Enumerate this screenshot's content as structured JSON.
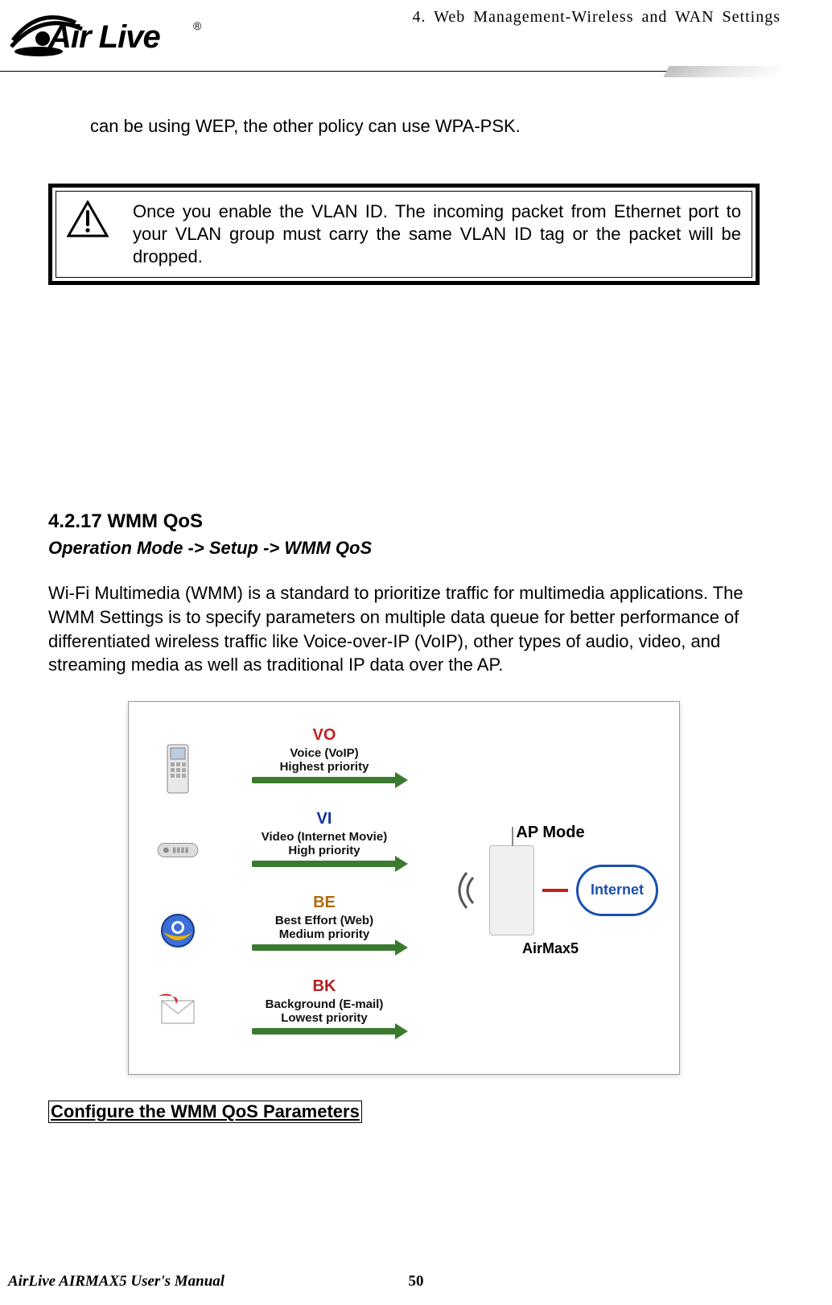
{
  "header": {
    "logo_name": "Air Live",
    "chapter_title": "4. Web Management-Wireless and WAN Settings"
  },
  "intro_line": "can be using WEP, the other policy can use WPA-PSK.",
  "warning_text": "Once you enable the VLAN ID.  The incoming packet from Ethernet port to your VLAN group must carry the same VLAN ID tag or the packet will be dropped.",
  "section": {
    "number": "4.2.17",
    "title": "WMM QoS",
    "breadcrumb": "Operation Mode -> Setup -> WMM QoS",
    "paragraph": "Wi-Fi Multimedia (WMM) is a standard to prioritize traffic for multimedia applications.   The WMM Settings is to specify parameters on multiple data queue for better performance of differentiated wireless traffic like Voice-over-IP (VoIP), other types of audio, video, and streaming media as well as traditional IP data over the AP.",
    "sub_heading": "Configure the WMM QoS Parameters"
  },
  "diagram": {
    "ap_mode_label": "AP Mode",
    "device_label": "AirMax5",
    "internet_label": "Internet",
    "rows": [
      {
        "code": "VO",
        "desc1": "Voice (VoIP)",
        "desc2": "Highest priority"
      },
      {
        "code": "VI",
        "desc1": "Video (Internet Movie)",
        "desc2": "High priority"
      },
      {
        "code": "BE",
        "desc1": "Best Effort (Web)",
        "desc2": "Medium priority"
      },
      {
        "code": "BK",
        "desc1": "Background (E-mail)",
        "desc2": "Lowest priority"
      }
    ]
  },
  "footer": {
    "manual_name": "AirLive AIRMAX5 User's Manual",
    "page_number": "50"
  }
}
